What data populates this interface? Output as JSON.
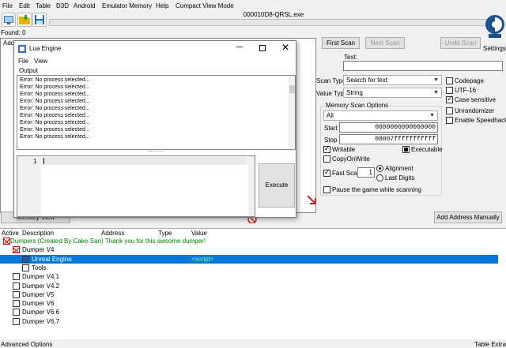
{
  "menu": [
    "File",
    "Edit",
    "Table",
    "D3D",
    "Android",
    "Emulator Memory",
    "Help",
    "Compact View Mode"
  ],
  "process_title": "000010D8-QRSL.exe",
  "found_label": "Found: 0",
  "results_header": "Addr",
  "settings_label": "Settings",
  "buttons": {
    "first_scan": "First Scan",
    "next_scan": "Next Scan",
    "undo_scan": "Undo Scan",
    "add_address_manually": "Add Address Manually",
    "memory_view": "Memory View"
  },
  "scan": {
    "text_label": "Text:",
    "text_value": "",
    "scan_type_label": "Scan Type",
    "scan_type_value": "Search for text",
    "value_type_label": "Value Type",
    "value_type_value": "String",
    "memory_scan_options_label": "Memory Scan Options",
    "region_value": "All",
    "start_label": "Start",
    "start_value": "0000000000000000",
    "stop_label": "Stop",
    "stop_value": "00007fffffffffff",
    "writable": "Writable",
    "executable": "Executable",
    "copy_on_write": "CopyOnWrite",
    "fast_scan": "Fast Scan",
    "fast_scan_value": "1",
    "alignment": "Alignment",
    "last_digits": "Last Digits",
    "pause_game": "Pause the game while scanning",
    "codepage": "Codepage",
    "utf16": "UTF-16",
    "case_sensitive": "Case sensitive",
    "unrandomizer": "Unrandomizer",
    "enable_speedhack": "Enable Speedhack"
  },
  "lua": {
    "title": "Lua Engine",
    "menu": [
      "File",
      "View"
    ],
    "output_label": "Output",
    "output_lines": [
      "Error: No process selected...",
      "Error: No process selected...",
      "Error: No process selected...",
      "Error: No process selected...",
      "Error: No process selected...",
      "Error: No process selected...",
      "Error: No process selected...",
      "Error: No process selected...",
      "Error: No process selected..."
    ],
    "line_number": "1",
    "execute_label": "Execute"
  },
  "addresses": {
    "columns": [
      "Active",
      "Description",
      "Address",
      "Type",
      "Value"
    ],
    "rows": [
      {
        "description": "Dumpers (Created By Cake-San) Thank you for this awsome dumper!",
        "value": "",
        "checked": "x",
        "indent": 0
      },
      {
        "description": "Dumper V4",
        "value": "",
        "checked": "x",
        "indent": 1
      },
      {
        "description": "Unreal Engine",
        "value": "<script>",
        "checked": "none",
        "indent": 2
      },
      {
        "description": "Tools",
        "value": "",
        "checked": "none",
        "indent": 2
      },
      {
        "description": "Dumper V4.1",
        "value": "",
        "checked": "none",
        "indent": 1
      },
      {
        "description": "Dumper V4.2",
        "value": "",
        "checked": "none",
        "indent": 1
      },
      {
        "description": "Dumper V5",
        "value": "",
        "checked": "none",
        "indent": 1
      },
      {
        "description": "Dumper V6",
        "value": "",
        "checked": "none",
        "indent": 1
      },
      {
        "description": "Dumper V6.6",
        "value": "",
        "checked": "none",
        "indent": 1
      },
      {
        "description": "Dumper V6.7",
        "value": "",
        "checked": "none",
        "indent": 1
      }
    ]
  },
  "footer": {
    "advanced_options": "Advanced Options",
    "table_extras": "Table Extras"
  },
  "colors": {
    "selection": "#0078d7",
    "script_text": "#00a000",
    "header_text": "#008000"
  }
}
